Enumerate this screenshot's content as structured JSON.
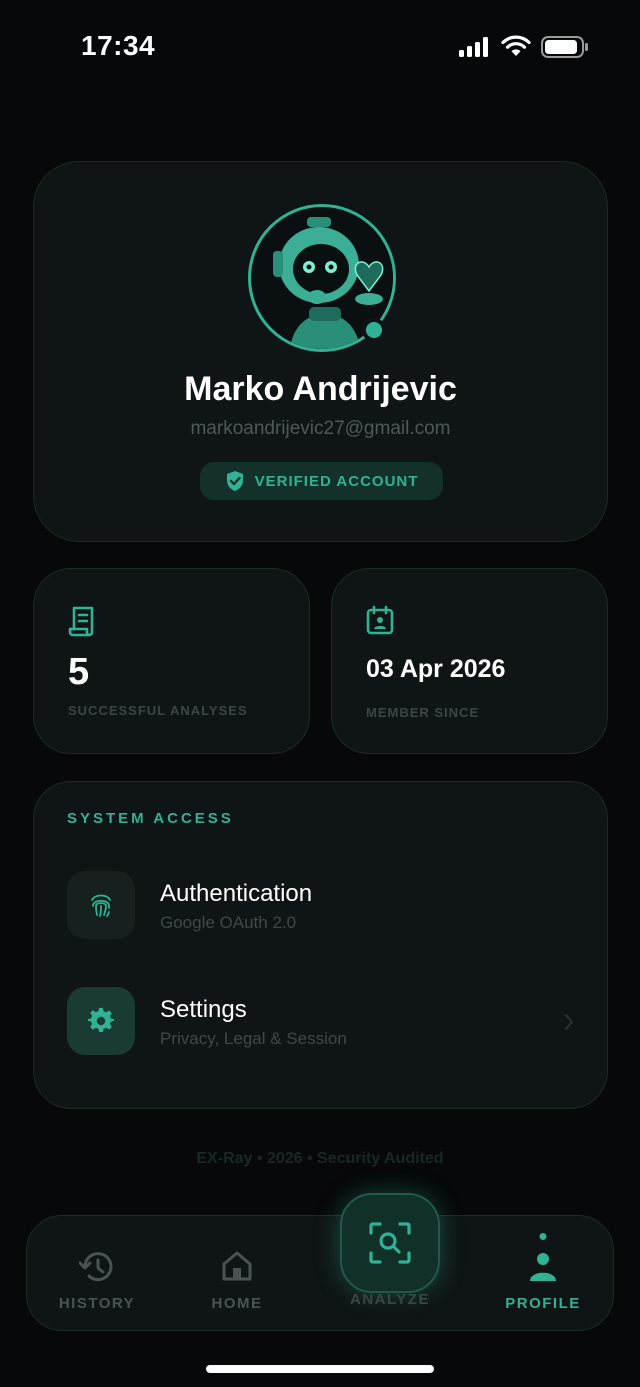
{
  "status_bar": {
    "time": "17:34"
  },
  "profile": {
    "name": "Marko Andrijevic",
    "email": "markoandrijevic27@gmail.com",
    "verified_label": "VERIFIED ACCOUNT"
  },
  "stats": [
    {
      "value": "5",
      "label": "SUCCESSFUL ANALYSES",
      "icon": "receipt-icon"
    },
    {
      "value": "03 Apr 2026",
      "label": "MEMBER SINCE",
      "icon": "calendar-icon"
    }
  ],
  "system_access": {
    "title": "SYSTEM ACCESS",
    "items": [
      {
        "title": "Authentication",
        "subtitle": "Google OAuth 2.0",
        "icon": "fingerprint-icon"
      },
      {
        "title": "Settings",
        "subtitle": "Privacy, Legal & Session",
        "icon": "gear-icon"
      }
    ]
  },
  "footer": "EX-Ray • 2026 • Security Audited",
  "nav": {
    "items": [
      {
        "label": "HISTORY",
        "icon": "history-icon"
      },
      {
        "label": "HOME",
        "icon": "home-icon"
      },
      {
        "label": "ANALYZE",
        "icon": "scan-search-icon"
      },
      {
        "label": "PROFILE",
        "icon": "person-icon"
      }
    ],
    "active": "PROFILE"
  },
  "colors": {
    "accent": "#2fb394",
    "background": "#060809",
    "card": "#0f1516"
  }
}
